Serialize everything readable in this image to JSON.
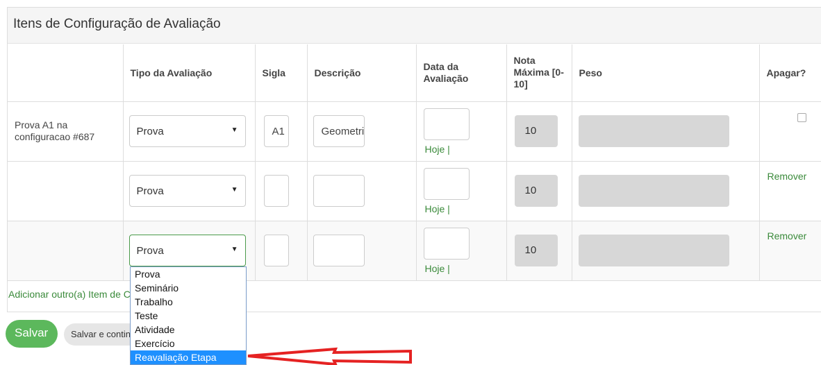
{
  "panel": {
    "title": "Itens de Configuração de Avaliação"
  },
  "headers": {
    "tipo": "Tipo da Avaliação",
    "sigla": "Sigla",
    "descricao": "Descrição",
    "data": [
      "Data da",
      "Avaliação"
    ],
    "nota": [
      "Nota",
      "Máxima [0-",
      "10]"
    ],
    "peso": "Peso",
    "apagar": "Apagar?"
  },
  "rows": [
    {
      "label": [
        "Prova A1 na",
        "configuracao #687"
      ],
      "tipo": "Prova",
      "sigla": "A1",
      "descricao": "Geometria",
      "hoje": "Hoje |",
      "nota": "10"
    },
    {
      "tipo": "Prova",
      "hoje": "Hoje |",
      "nota": "10",
      "remover": "Remover"
    },
    {
      "tipo": "Prova",
      "hoje": "Hoje |",
      "nota": "10",
      "remover": "Remover"
    }
  ],
  "add_link": "Adicionar outro(a) Item de Configuração de Avaliação",
  "buttons": {
    "save": "Salvar",
    "save_continue": "Salvar e continuar editando"
  },
  "dropdown": {
    "options": [
      "Prova",
      "Seminário",
      "Trabalho",
      "Teste",
      "Atividade",
      "Exercício",
      "Reavaliação Etapa"
    ],
    "highlighted": "Reavaliação Etapa"
  },
  "colors": {
    "link_green": "#3a8a3a",
    "save_green": "#5cb85c",
    "highlight_blue": "#1e90ff",
    "annotation_red": "#e52222"
  },
  "icons": {
    "select_arrow": "▼",
    "annotation": "red-arrow-icon"
  }
}
